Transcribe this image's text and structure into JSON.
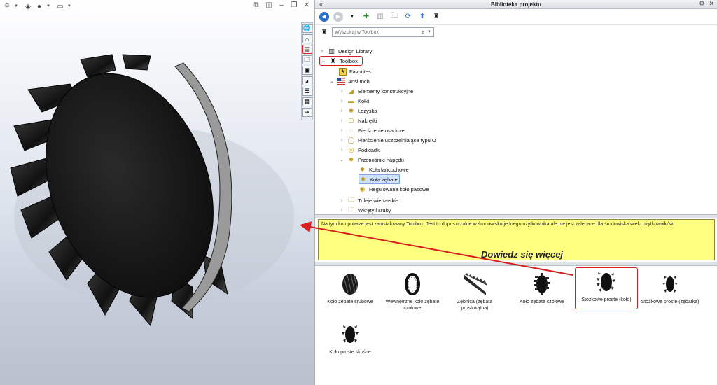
{
  "panel": {
    "title": "Biblioteka projektu"
  },
  "search": {
    "placeholder": "Wyszukaj w Toolbox"
  },
  "tree": {
    "design_library": "Design Library",
    "toolbox": "Toolbox",
    "favorites": "Favorites",
    "ansi_inch": "Ansi Inch",
    "elementy": "Elementy konstrukcyjne",
    "kolki": "Kołki",
    "lozyska": "Łożyska",
    "nakretki": "Nakrętki",
    "pierscienie_osadcze": "Pierścienie osadcze",
    "pierscienie_uszcz": "Pierścienie uszczelniające typu O",
    "podkladki": "Podkładki",
    "przenosniki": "Przenośniki napędu",
    "kola_lancuchowe": "Koła łańcuchowe",
    "kola_zebate": "Koła zębate",
    "regulowane": "Regulowane koło pasowe",
    "tuleje": "Tuleje wiertarskie",
    "wkrety": "Wkręty i śruby"
  },
  "notice": {
    "text": "Na tym komputerze jest zainstalowany Toolbox. Jest to dopuszczalne w środowisku jednego użytkownika ale nie jest zalecane dla środowiska wielu użytkowników.",
    "more": "Dowiedz się więcej"
  },
  "gallery": {
    "items": [
      "Koło zębate śrubowe",
      "Wewnętrzne koło zębate czołowe",
      "Zębnica (zębata prostokątna)",
      "Koło zębate czołowe",
      "Stożkowe proste (koło)",
      "Stożkowe proste (zębatka)",
      "Koło proste skośne"
    ]
  },
  "colors": {
    "highlight": "#d71d1d",
    "notice_bg": "#ffff80",
    "selection": "#cfe2fb"
  }
}
